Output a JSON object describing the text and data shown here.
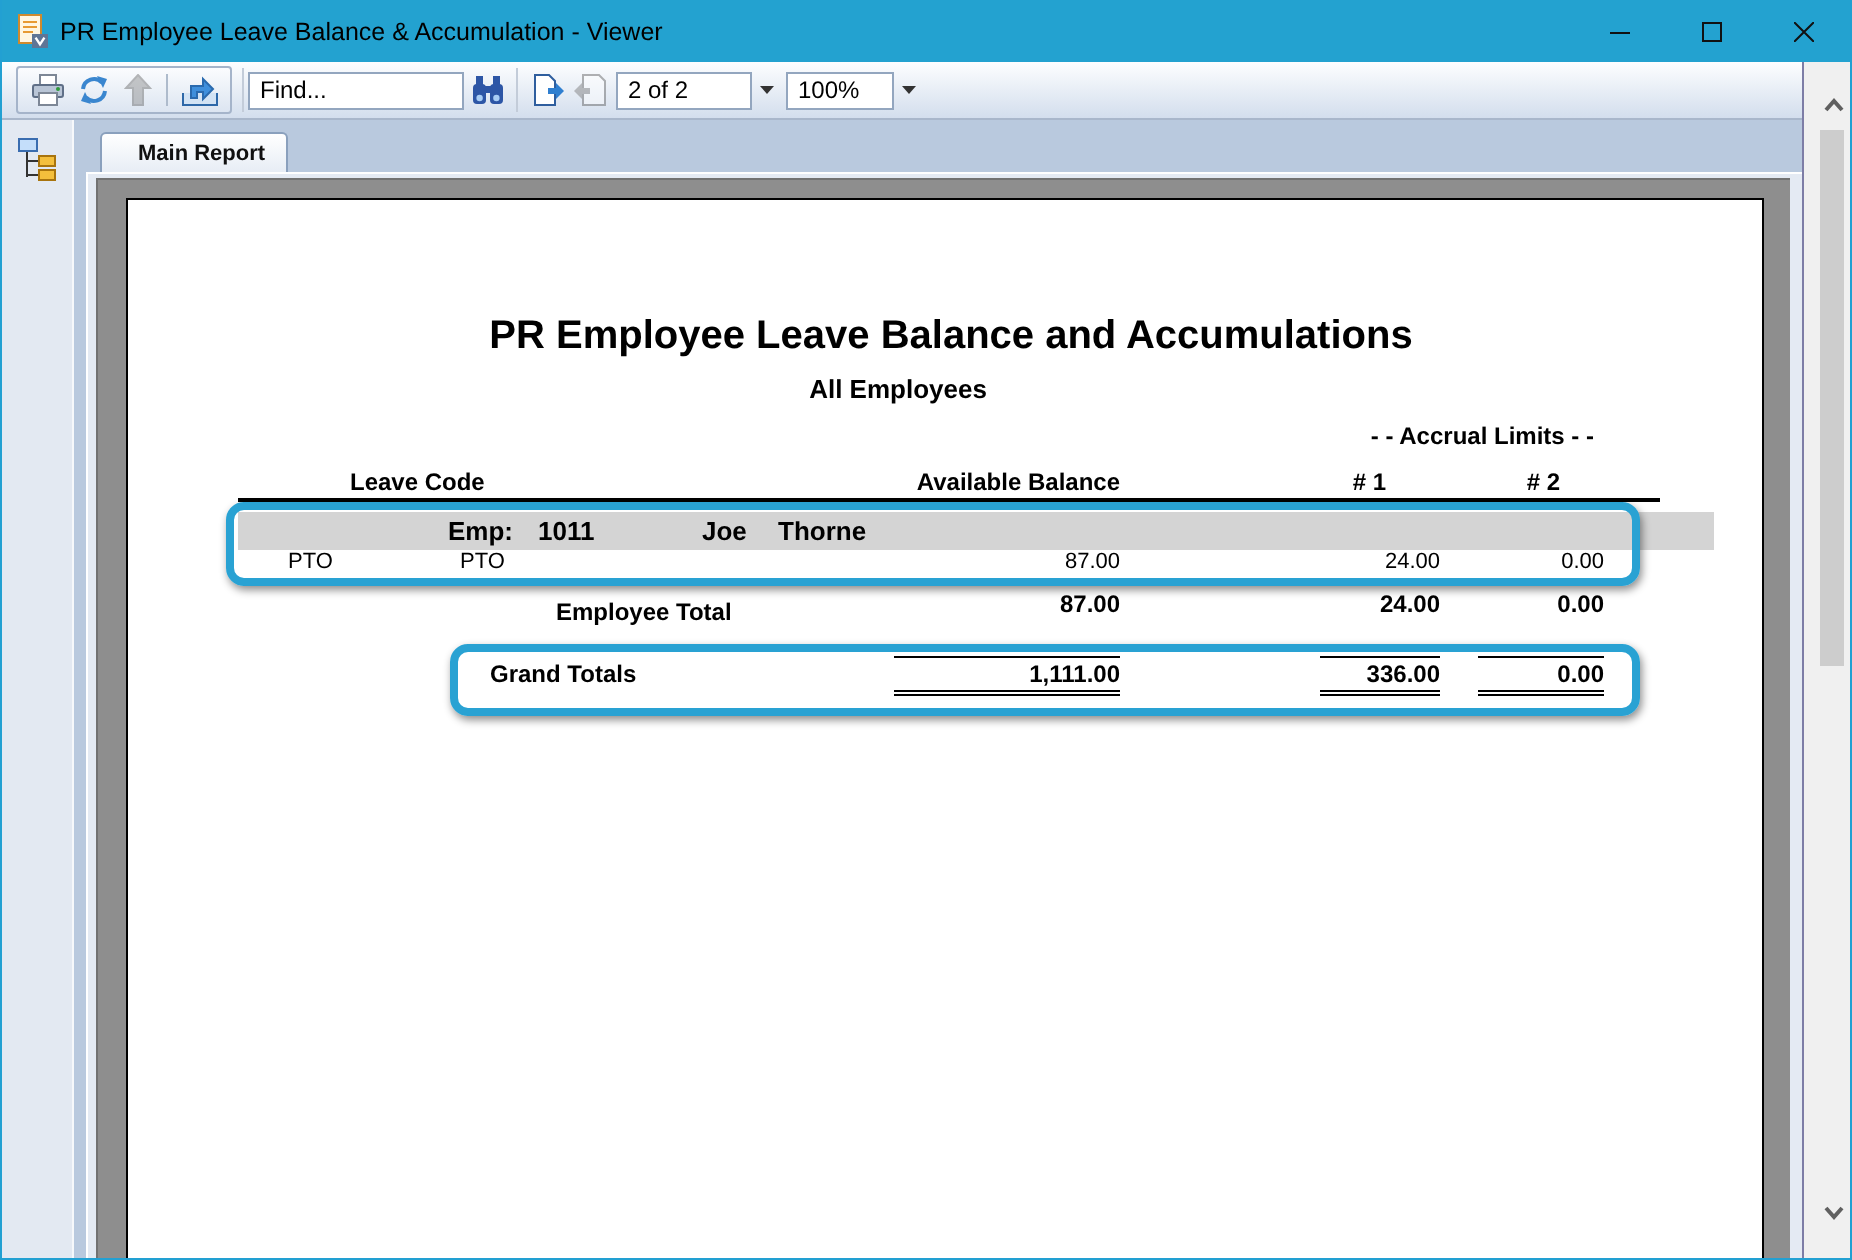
{
  "window": {
    "title": "PR Employee Leave Balance & Accumulation - Viewer"
  },
  "toolbar": {
    "report_tools": [
      {
        "kind": "print",
        "disabled": false
      },
      {
        "kind": "refresh",
        "disabled": false
      },
      {
        "kind": "arrow_up",
        "disabled": true
      },
      {
        "kind": "export",
        "disabled": false
      }
    ],
    "find": {
      "placeholder": "Find..."
    },
    "page_tools": [
      {
        "kind": "page_arrow_right",
        "disabled": false
      },
      {
        "kind": "page_arrow_left",
        "disabled": true
      }
    ],
    "page": {
      "value": "2 of 2"
    },
    "zoom": {
      "value": "100%"
    }
  },
  "tabs": [
    {
      "label": "Main Report",
      "selected": true
    }
  ],
  "report": {
    "title": "PR Employee Leave Balance and Accumulations",
    "subtitle": "All Employees",
    "column_group": "- - Accrual Limits - -",
    "columns": [
      "Leave Code",
      "Available Balance",
      "# 1",
      "# 2"
    ],
    "groups": [
      {
        "highlighted": true,
        "employee": {
          "label": "Emp:",
          "id": "1011",
          "first_name": "Joe",
          "last_name": "Thorne"
        },
        "rows": [
          {
            "code": "PTO",
            "description": "PTO",
            "available_balance": "87.00",
            "limit_1": "24.00",
            "limit_2": "0.00"
          }
        ],
        "total": {
          "label": "Employee Total",
          "available_balance": "87.00",
          "limit_1": "24.00",
          "limit_2": "0.00"
        }
      }
    ],
    "grand_total": {
      "highlighted": true,
      "label": "Grand Totals",
      "available_balance": "1,111.00",
      "limit_1": "336.00",
      "limit_2": "0.00"
    }
  }
}
